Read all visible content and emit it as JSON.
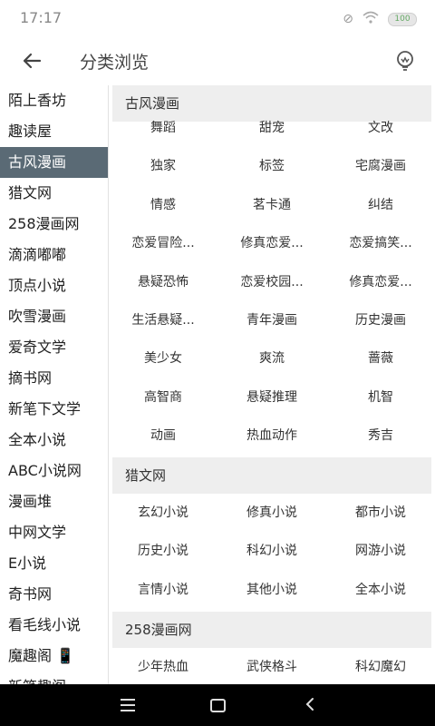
{
  "status": {
    "time": "17:17",
    "battery": "100"
  },
  "appbar": {
    "title": "分类浏览"
  },
  "sidebar": {
    "items": [
      {
        "label": "陌上香坊"
      },
      {
        "label": "趣读屋"
      },
      {
        "label": "古风漫画"
      },
      {
        "label": "猎文网"
      },
      {
        "label": "258漫画网"
      },
      {
        "label": "滴滴嘟嘟"
      },
      {
        "label": "顶点小说"
      },
      {
        "label": "吹雪漫画"
      },
      {
        "label": "爱奇文学"
      },
      {
        "label": "摘书网"
      },
      {
        "label": "新笔下文学"
      },
      {
        "label": "全本小说"
      },
      {
        "label": "ABC小说网"
      },
      {
        "label": "漫画堆"
      },
      {
        "label": "中网文学"
      },
      {
        "label": "E小说"
      },
      {
        "label": "奇书网"
      },
      {
        "label": "看毛线小说"
      },
      {
        "label": "魔趣阁 📱"
      },
      {
        "label": "新笔趣阁"
      }
    ],
    "active_index": 2
  },
  "content": {
    "sections": [
      {
        "title": "古风漫画",
        "items": [
          "舞蹈",
          "甜宠",
          "文改",
          "独家",
          "标签",
          "宅腐漫画",
          "情感",
          "茗卡通",
          "纠结",
          "恋爱冒险...",
          "修真恋爱...",
          "恋爱搞笑...",
          "悬疑恐怖",
          "恋爱校园...",
          "修真恋爱...",
          "生活悬疑...",
          "青年漫画",
          "历史漫画",
          "美少女",
          "爽流",
          "蔷薇",
          "高智商",
          "悬疑推理",
          "机智",
          "动画",
          "热血动作",
          "秀吉"
        ]
      },
      {
        "title": "猎文网",
        "items": [
          "玄幻小说",
          "修真小说",
          "都市小说",
          "历史小说",
          "科幻小说",
          "网游小说",
          "言情小说",
          "其他小说",
          "全本小说"
        ]
      },
      {
        "title": "258漫画网",
        "items": [
          "少年热血",
          "武侠格斗",
          "科幻魔幻"
        ]
      }
    ]
  },
  "colors": {
    "active_bg": "#5a6a75",
    "section_bg": "#eeeeee",
    "navbar": "#000000"
  }
}
